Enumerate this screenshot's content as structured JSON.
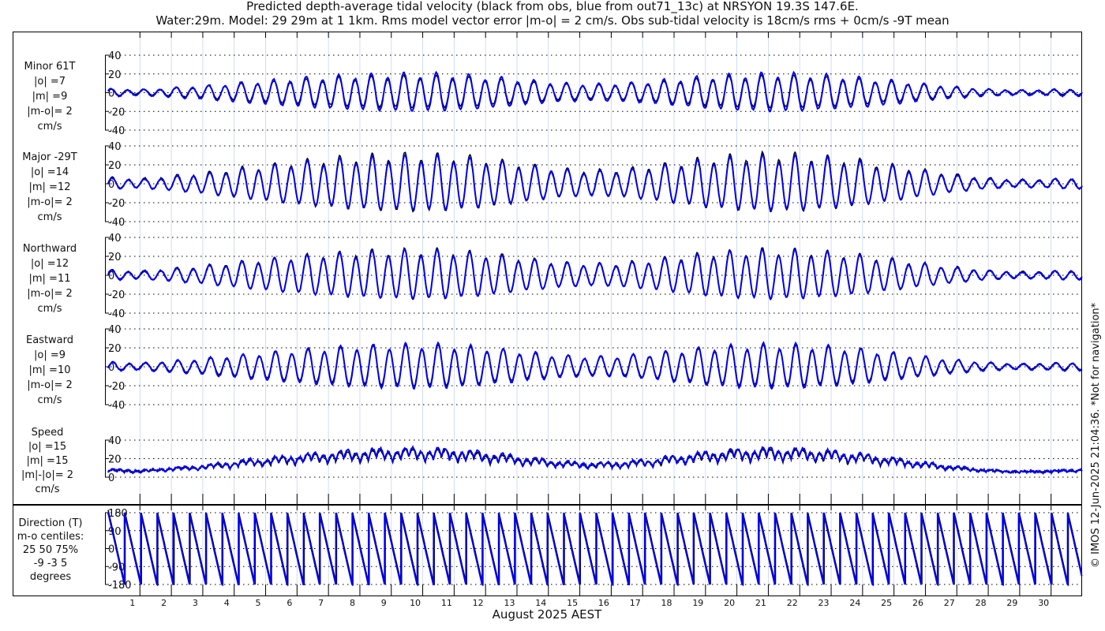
{
  "chart_data": {
    "type": "line",
    "title": "Predicted depth-average tidal velocity (black from obs, blue from out71_13c) at NRSYON 19.3S 147.6E.",
    "subtitle": "Water:29m. Model: 29 29m at 1 1km. Rms model vector error |m-o| = 2 cm/s. Obs sub-tidal velocity is 18cm/s rms + 0cm/s -9T mean",
    "xlabel": "August 2025 AEST",
    "x_ticks": [
      "1",
      "2",
      "3",
      "4",
      "5",
      "6",
      "7",
      "8",
      "9",
      "10",
      "11",
      "12",
      "13",
      "14",
      "15",
      "16",
      "17",
      "18",
      "19",
      "20",
      "21",
      "22",
      "23",
      "24",
      "25",
      "26",
      "27",
      "28",
      "29",
      "30"
    ],
    "xlim_days": [
      0,
      31
    ],
    "legend": {
      "obs": "black",
      "model": "blue"
    },
    "colors": {
      "obs": "#000000",
      "model": "#0000ee"
    },
    "copyright": "© IMOS 12-Jun-2025 21:04:36. *Not for navigation*",
    "envelope_days": [
      0,
      1,
      2,
      3,
      4,
      5,
      6,
      7,
      8,
      9,
      10,
      11,
      12,
      13,
      14,
      15,
      16,
      17,
      18,
      19,
      20,
      21,
      22,
      23,
      24,
      25,
      26,
      27,
      28,
      29,
      30,
      31
    ],
    "envelope": [
      0.2,
      0.15,
      0.25,
      0.35,
      0.5,
      0.62,
      0.75,
      0.85,
      0.93,
      0.98,
      1.0,
      0.96,
      0.85,
      0.7,
      0.55,
      0.45,
      0.45,
      0.55,
      0.7,
      0.85,
      0.95,
      1.0,
      0.98,
      0.9,
      0.78,
      0.62,
      0.45,
      0.3,
      0.18,
      0.12,
      0.15,
      0.2
    ],
    "panels": [
      {
        "label": [
          "Minor 61T",
          "|o| =7",
          "|m| =9",
          "|m-o|= 2",
          "cm/s"
        ],
        "ylim": [
          -40,
          40
        ],
        "yticks": [
          "40",
          "20",
          "0",
          "-20",
          "-40"
        ],
        "amp_obs": 16,
        "amp_model": 19,
        "kind": "vel",
        "phase": 0.4
      },
      {
        "label": [
          "Major -29T",
          "|o| =14",
          "|m| =12",
          "|m-o|= 2",
          "cm/s"
        ],
        "ylim": [
          -40,
          40
        ],
        "yticks": [
          "40",
          "20",
          "0",
          "-20",
          "-40"
        ],
        "amp_obs": 29,
        "amp_model": 27,
        "kind": "vel",
        "phase": 0
      },
      {
        "label": [
          "Northward",
          "|o| =12",
          "|m| =11",
          "|m-o|= 2",
          "cm/s"
        ],
        "ylim": [
          -40,
          40
        ],
        "yticks": [
          "40",
          "20",
          "0",
          "-20",
          "-40"
        ],
        "amp_obs": 25,
        "amp_model": 24,
        "kind": "vel",
        "phase": 0.1
      },
      {
        "label": [
          "Eastward",
          "|o| =9",
          "|m| =10",
          "|m-o|= 2",
          "cm/s"
        ],
        "ylim": [
          -40,
          40
        ],
        "yticks": [
          "40",
          "20",
          "0",
          "-20",
          "-40"
        ],
        "amp_obs": 20,
        "amp_model": 22,
        "kind": "vel",
        "phase": -0.3
      },
      {
        "label": [
          "Speed",
          "|o| =15",
          "|m| =15",
          "|m|-|o|= 2",
          "cm/s"
        ],
        "ylim": [
          0,
          40
        ],
        "yticks": [
          "40",
          "20",
          "0"
        ],
        "amp_obs": 28,
        "amp_model": 30,
        "kind": "speed",
        "phase": 0
      }
    ],
    "direction": {
      "label": [
        "Direction (T)",
        "m-o centiles:",
        "25  50  75%",
        "-9 -3  5",
        "degrees"
      ],
      "ylim": [
        -180,
        180
      ],
      "yticks": [
        "180",
        "90",
        "0",
        "-90",
        "-180"
      ]
    }
  }
}
